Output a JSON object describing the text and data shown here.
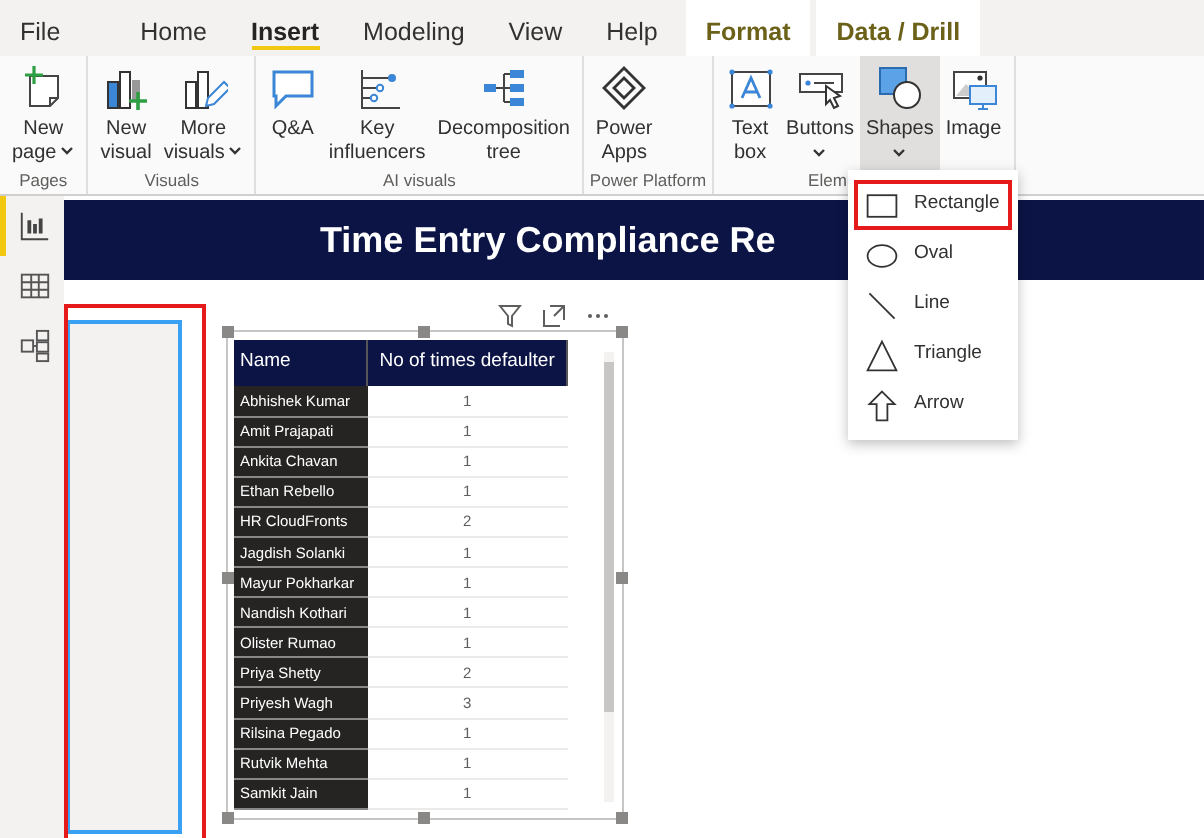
{
  "tabs": [
    {
      "label": "File",
      "selected": false,
      "kind": "plain"
    },
    {
      "label": "Home",
      "selected": false,
      "kind": "plain"
    },
    {
      "label": "Insert",
      "selected": true,
      "kind": "plain"
    },
    {
      "label": "Modeling",
      "selected": false,
      "kind": "plain"
    },
    {
      "label": "View",
      "selected": false,
      "kind": "plain"
    },
    {
      "label": "Help",
      "selected": false,
      "kind": "plain"
    },
    {
      "label": "Format",
      "selected": false,
      "kind": "contextual"
    },
    {
      "label": "Data / Drill",
      "selected": false,
      "kind": "contextual"
    }
  ],
  "ribbon": [
    {
      "label": "Pages",
      "buttons": [
        {
          "label_lines": [
            "New",
            "page"
          ],
          "has_menu": true,
          "pressed": false
        }
      ]
    },
    {
      "label": "Visuals",
      "buttons": [
        {
          "label_lines": [
            "New",
            "visual"
          ],
          "has_menu": false,
          "pressed": false
        },
        {
          "label_lines": [
            "More",
            "visuals"
          ],
          "has_menu": true,
          "pressed": false
        }
      ]
    },
    {
      "label": "AI visuals",
      "buttons": [
        {
          "label_lines": [
            "Q&A"
          ],
          "has_menu": false,
          "pressed": false
        },
        {
          "label_lines": [
            "Key",
            "influencers"
          ],
          "has_menu": false,
          "pressed": false
        },
        {
          "label_lines": [
            "Decomposition",
            "tree"
          ],
          "has_menu": false,
          "pressed": false
        }
      ]
    },
    {
      "label": "Power Platform",
      "buttons": [
        {
          "label_lines": [
            "Power",
            "Apps"
          ],
          "has_menu": false,
          "pressed": false
        }
      ]
    },
    {
      "label": "Elem",
      "buttons": [
        {
          "label_lines": [
            "Text",
            "box"
          ],
          "has_menu": false,
          "pressed": false
        },
        {
          "label_lines": [
            "Buttons"
          ],
          "has_menu": true,
          "pressed": false
        },
        {
          "label_lines": [
            "Shapes"
          ],
          "has_menu": true,
          "pressed": true
        },
        {
          "label_lines": [
            "Image"
          ],
          "has_menu": false,
          "pressed": false
        }
      ]
    }
  ],
  "view_nav": [
    {
      "selected": true
    },
    {
      "selected": false
    },
    {
      "selected": false
    }
  ],
  "report": {
    "title": "Time Entry Compliance Re",
    "rectangle_shape": {
      "annotated": true
    },
    "table": {
      "columns": [
        "Name",
        "No of times defaulter"
      ],
      "rows": [
        [
          "Abhishek Kumar",
          "1"
        ],
        [
          "Amit Prajapati",
          "1"
        ],
        [
          "Ankita Chavan",
          "1"
        ],
        [
          "Ethan Rebello",
          "1"
        ],
        [
          "HR CloudFronts",
          "2"
        ],
        [
          "Jagdish Solanki",
          "1"
        ],
        [
          "Mayur Pokharkar",
          "1"
        ],
        [
          "Nandish Kothari",
          "1"
        ],
        [
          "Olister Rumao",
          "1"
        ],
        [
          "Priya Shetty",
          "2"
        ],
        [
          "Priyesh Wagh",
          "3"
        ],
        [
          "Rilsina Pegado",
          "1"
        ],
        [
          "Rutvik Mehta",
          "1"
        ],
        [
          "Samkit Jain",
          "1"
        ]
      ]
    }
  },
  "shapes_menu": [
    {
      "label": "Rectangle",
      "highlighted": true
    },
    {
      "label": "Oval",
      "highlighted": false
    },
    {
      "label": "Line",
      "highlighted": false
    },
    {
      "label": "Triangle",
      "highlighted": false
    },
    {
      "label": "Arrow",
      "highlighted": false
    }
  ]
}
